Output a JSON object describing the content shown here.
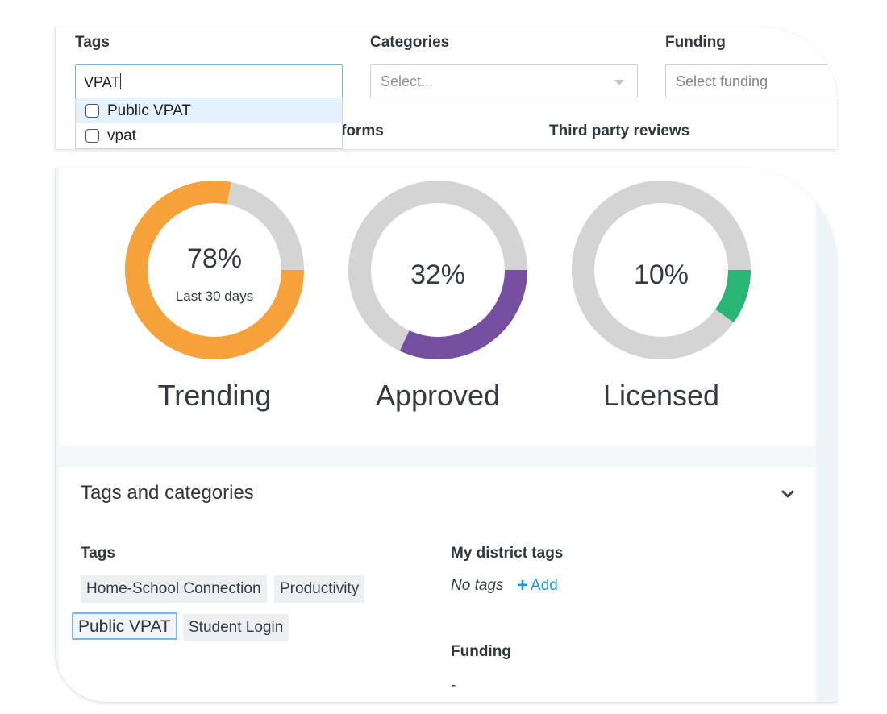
{
  "filters": {
    "tags_label": "Tags",
    "tags_value": "VPAT",
    "categories_label": "Categories",
    "categories_placeholder": "Select...",
    "funding_label": "Funding",
    "funding_placeholder": "Select funding",
    "dropdown_options": [
      "Public VPAT",
      "vpat"
    ],
    "hidden_label_fragment": "forms",
    "third_party_label": "Third party reviews"
  },
  "stats": [
    {
      "name": "Trending",
      "percent_label": "78%",
      "value": 78,
      "subtitle": "Last 30 days",
      "color": "#f7a13a"
    },
    {
      "name": "Approved",
      "percent_label": "32%",
      "value": 32,
      "subtitle": "",
      "color": "#764fa0"
    },
    {
      "name": "Licensed",
      "percent_label": "10%",
      "value": 10,
      "subtitle": "",
      "color": "#29b675"
    }
  ],
  "ring_track_color": "#d4d4d4",
  "tags_section": {
    "title": "Tags and categories",
    "tags_label": "Tags",
    "tags": [
      "Home-School Connection",
      "Productivity",
      "Public VPAT",
      "Student Login"
    ],
    "district_tags_label": "My district tags",
    "no_tags": "No tags",
    "add_label": "Add",
    "funding_label": "Funding",
    "funding_value": "-"
  }
}
